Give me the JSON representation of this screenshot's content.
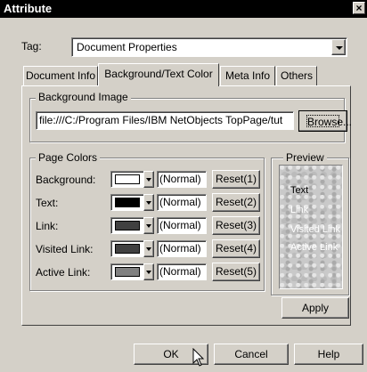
{
  "window": {
    "title": "Attribute",
    "close": "×"
  },
  "tag": {
    "label": "Tag:",
    "value": "Document Properties"
  },
  "tabs": [
    {
      "label": "Document Info"
    },
    {
      "label": "Background/Text Color"
    },
    {
      "label": "Meta Info"
    },
    {
      "label": "Others"
    }
  ],
  "background_image": {
    "group_label": "Background Image",
    "path": "file:///C:/Program Files/IBM NetObjects TopPage/tut",
    "browse_label": "Browse..."
  },
  "page_colors": {
    "group_label": "Page Colors",
    "rows": [
      {
        "label": "Background:",
        "swatch": "#ffffff",
        "value": "(Normal)",
        "reset": "Reset(1)"
      },
      {
        "label": "Text:",
        "swatch": "#000000",
        "value": "(Normal)",
        "reset": "Reset(2)"
      },
      {
        "label": "Link:",
        "swatch": "#404040",
        "value": "(Normal)",
        "reset": "Reset(3)"
      },
      {
        "label": "Visited Link:",
        "swatch": "#404040",
        "value": "(Normal)",
        "reset": "Reset(4)"
      },
      {
        "label": "Active Link:",
        "swatch": "#808080",
        "value": "(Normal)",
        "reset": "Reset(5)"
      }
    ]
  },
  "preview": {
    "group_label": "Preview",
    "items": [
      "Text",
      "Link",
      "Visited Link",
      "Active Link"
    ],
    "colors": [
      "#000000",
      "#ffffff",
      "#ffffff",
      "#ffffff"
    ]
  },
  "apply_label": "Apply",
  "footer": {
    "ok": "OK",
    "cancel": "Cancel",
    "help": "Help"
  }
}
